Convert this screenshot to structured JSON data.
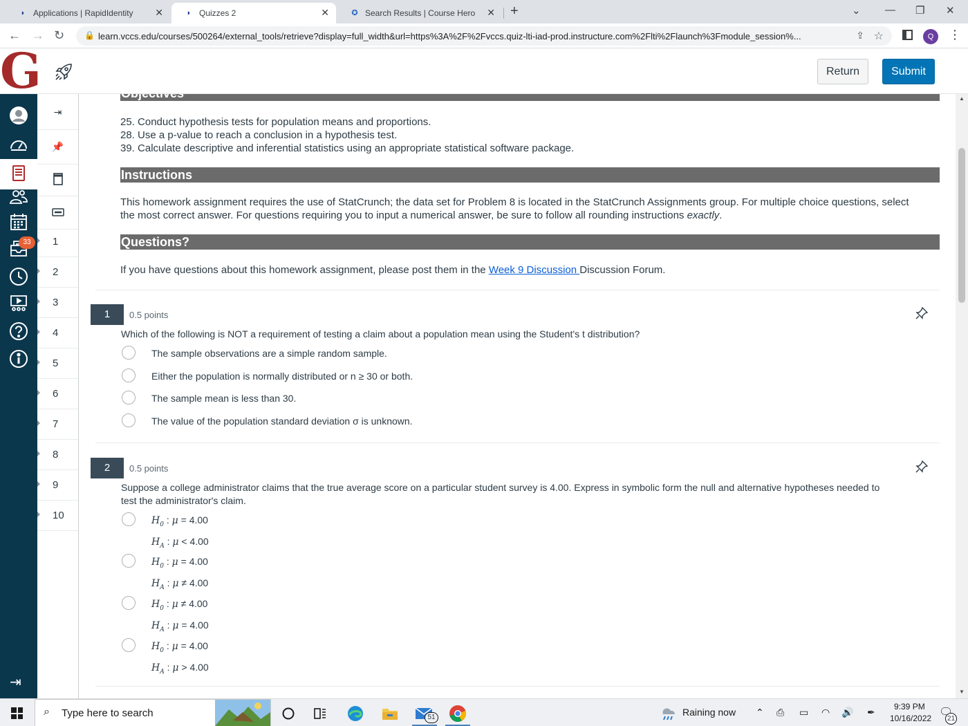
{
  "browser": {
    "tabs": [
      {
        "title": "Applications | RapidIdentity"
      },
      {
        "title": "Quizzes 2"
      },
      {
        "title": "Search Results | Course Hero"
      }
    ],
    "url": "learn.vccs.edu/courses/500264/external_tools/retrieve?display=full_width&url=https%3A%2F%2Fvccs.quiz-lti-iad-prod.instructure.com%2Flti%2Flaunch%3Fmodule_session%...",
    "profile_initial": "Q"
  },
  "header": {
    "logo": "G",
    "return_label": "Return",
    "submit_label": "Submit"
  },
  "global_nav": {
    "inbox_badge": "33"
  },
  "question_nav": {
    "items": [
      "1",
      "2",
      "3",
      "4",
      "5",
      "6",
      "7",
      "8",
      "9",
      "10"
    ]
  },
  "content": {
    "objectives_heading": "Objectives",
    "objectives": [
      "25. Conduct hypothesis tests for population means and proportions.",
      "28. Use a p-value to reach a conclusion in a hypothesis test.",
      "39. Calculate descriptive and inferential statistics using an appropriate statistical software package."
    ],
    "instructions_heading": "Instructions",
    "instructions_line1": "This homework assignment requires the use of StatCrunch; the data set for Problem 8 is located in the StatCrunch Assignments group. For multiple choice questions, select",
    "instructions_line2_pre": "the most correct answer. For questions requiring you to input a numerical answer, be sure to follow all rounding instructions ",
    "instructions_line2_em": "exactly",
    "instructions_line2_post": ".",
    "questions_heading": "Questions?",
    "questions_pre": "If you have questions about this homework assignment, please post them in the ",
    "questions_link": "Week 9 Discussion ",
    "questions_post": " Discussion Forum."
  },
  "questions": [
    {
      "number": "1",
      "points": "0.5 points",
      "text": "Which of the following is NOT a requirement of testing a claim about a population mean using the Student's t distribution?",
      "options": [
        "The sample observations are a simple random sample.",
        "Either the population is normally distributed or n ≥ 30 or both.",
        "The sample mean is less than 30.",
        "The value of the population standard deviation σ is unknown."
      ]
    },
    {
      "number": "2",
      "points": "0.5 points",
      "text_line1": "Suppose a college administrator claims that the true average score on a particular student survey is 4.00. Express in symbolic form the null and alternative hypotheses needed to",
      "text_line2": "test the administrator's claim.",
      "options": [
        {
          "h0": "= 4.00",
          "ha": "< 4.00"
        },
        {
          "h0": "= 4.00",
          "ha": "≠ 4.00"
        },
        {
          "h0": "≠ 4.00",
          "ha": "= 4.00"
        },
        {
          "h0": "= 4.00",
          "ha": "> 4.00"
        }
      ]
    }
  ],
  "taskbar": {
    "search_placeholder": "Type here to search",
    "mail_badge": "51",
    "weather": "Raining now",
    "time": "9:39 PM",
    "date": "10/16/2022",
    "notification_count": "21"
  }
}
